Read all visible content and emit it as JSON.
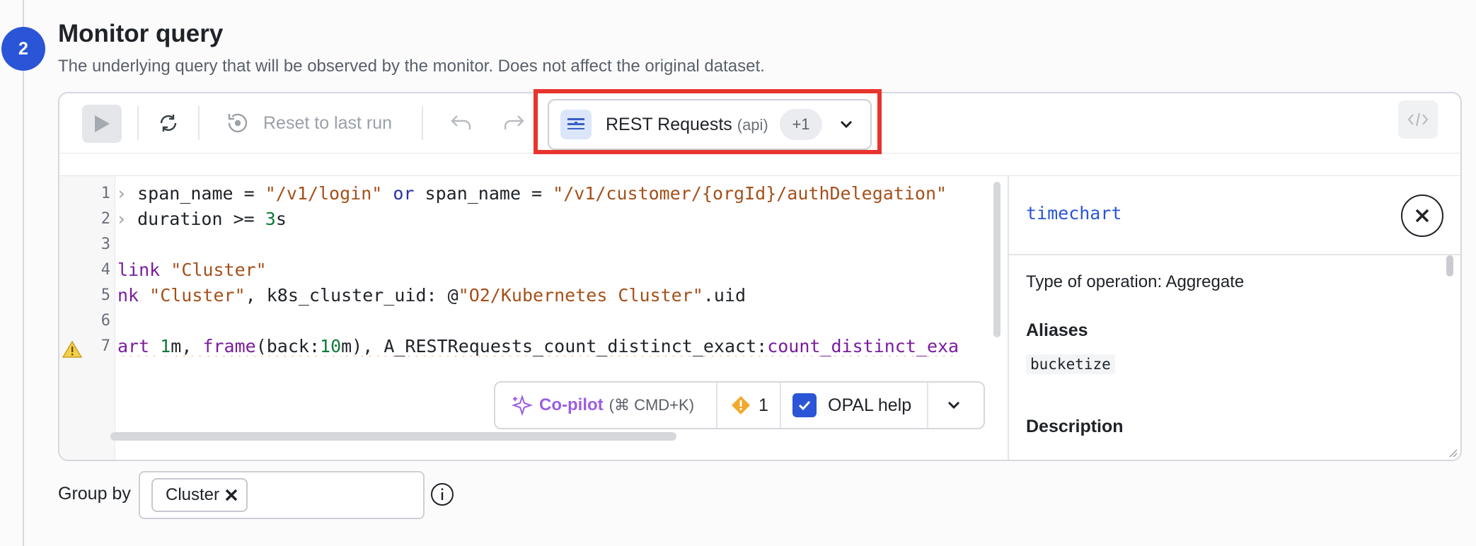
{
  "step": {
    "number": "2",
    "title": "Monitor query",
    "subtitle": "The underlying query that will be observed by the monitor. Does not affect the original dataset."
  },
  "toolbar": {
    "run_icon": "play-icon",
    "refresh_icon": "refresh-icon",
    "reset_icon": "reset-icon",
    "reset_label": "Reset to last run",
    "undo_icon": "undo-icon",
    "redo_icon": "redo-icon",
    "code_icon": "code-icon"
  },
  "dataset": {
    "name": "REST Requests",
    "sub": "(api)",
    "extra": "+1",
    "icon": "dataset-table-icon"
  },
  "code": {
    "line_numbers": [
      "1",
      "2",
      "3",
      "4",
      "5",
      "6",
      "7"
    ],
    "lines": [
      {
        "p1": "span_name = ",
        "s1": "\"/v1/login\"",
        "k1": " or ",
        "p2": "span_name = ",
        "s2": "\"/v1/customer/{orgId}/authDelegation\""
      },
      {
        "p1": "duration >= ",
        "n1": "3",
        "p2": "s"
      },
      {},
      {
        "p1": "link ",
        "s1": "\"Cluster\""
      },
      {
        "p1": "nk ",
        "s1": "\"Cluster\"",
        "p2": ", k8s_cluster_uid: @",
        "s2": "\"O2/Kubernetes Cluster\"",
        "p3": ".uid"
      },
      {},
      {
        "p1": "art ",
        "n1": "1",
        "p2": "m, ",
        "f1": "frame",
        "p3": "(back:",
        "n2": "10",
        "p4": "m), A_RESTRequests_count_distinct_exact:",
        "f2": "count_distinct_exa"
      }
    ],
    "line1_mark": "›",
    "line2_mark": "›",
    "warn_line_icon": "warning-triangle-icon"
  },
  "copilot": {
    "label": "Co-pilot",
    "shortcut": "(⌘ CMD+K)",
    "icon": "sparkle-icon",
    "warning_count": "1",
    "warning_icon": "warning-diamond-icon",
    "opal_help_label": "OPAL help",
    "opal_help_checked": true,
    "menu_icon": "chevron-down-icon"
  },
  "docs": {
    "name": "timechart",
    "operation_type": "Type of operation: Aggregate",
    "aliases_heading": "Aliases",
    "alias": "bucketize",
    "description_heading": "Description",
    "close_icon": "close-icon"
  },
  "group_by": {
    "label": "Group by",
    "chip": "Cluster",
    "chip_remove_icon": "x-icon",
    "info_icon": "info-icon"
  },
  "colors": {
    "accent": "#2a55d6",
    "highlight": "#e8342c",
    "copilot": "#9b5fe0",
    "warning": "#f0a92e"
  }
}
